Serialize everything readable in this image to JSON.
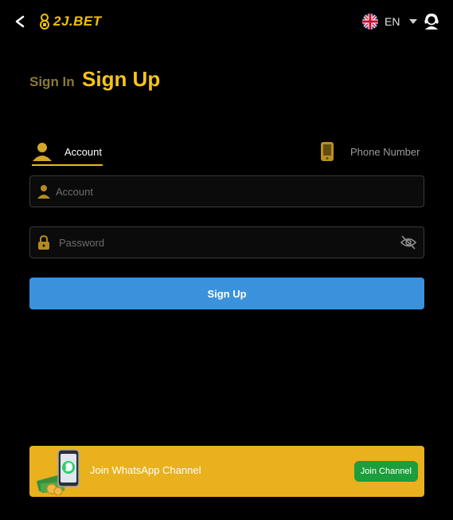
{
  "header": {
    "logo_text": "2J.BET",
    "language_code": "EN"
  },
  "tabs": {
    "sign_in": "Sign In",
    "sign_up": "Sign Up"
  },
  "methods": {
    "account": "Account",
    "phone": "Phone Number"
  },
  "form": {
    "account_placeholder": "Account",
    "password_placeholder": "Password",
    "submit_label": "Sign Up"
  },
  "banner": {
    "text": "Join WhatsApp Channel",
    "button_label": "Join Channel"
  },
  "colors": {
    "accent_gold": "#f5c518",
    "primary_blue": "#3a92dc",
    "banner_gold": "#e8b11d",
    "whatsapp_green": "#1b9e3b"
  }
}
